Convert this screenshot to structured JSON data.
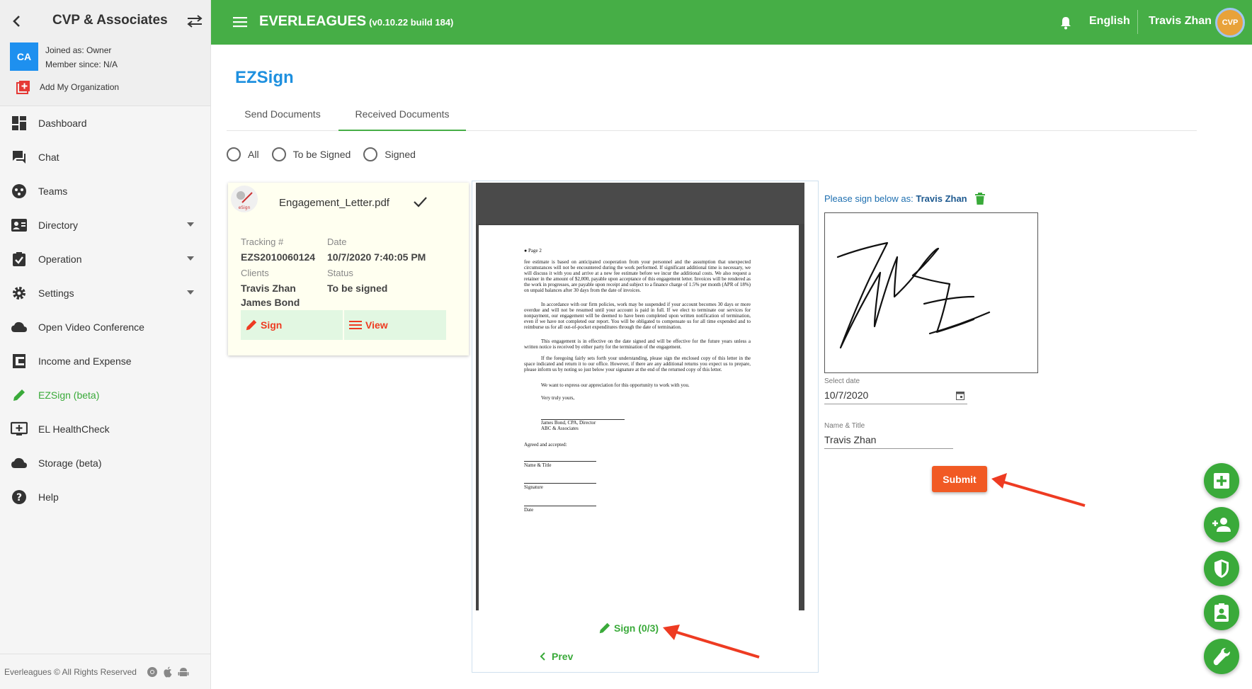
{
  "org": {
    "name": "CVP & Associates",
    "avatar": "CA",
    "joined": "Joined as: Owner",
    "member_since": "Member since: N/A",
    "add_org": "Add My Organization"
  },
  "nav": [
    {
      "label": "Dashboard",
      "icon": "dashboard-icon"
    },
    {
      "label": "Chat",
      "icon": "chat-icon"
    },
    {
      "label": "Teams",
      "icon": "teams-icon"
    },
    {
      "label": "Directory",
      "icon": "directory-icon"
    },
    {
      "label": "Operation",
      "icon": "clipboard-check-icon"
    },
    {
      "label": "Settings",
      "icon": "gear-icon"
    },
    {
      "label": "Open Video Conference",
      "icon": "cloud-icon"
    },
    {
      "label": "Income and Expense",
      "icon": "ledger-icon"
    },
    {
      "label": "EZSign (beta)",
      "icon": "pencil-icon"
    },
    {
      "label": "EL HealthCheck",
      "icon": "monitor-plus-icon"
    },
    {
      "label": "Storage (beta)",
      "icon": "cloud-storage-icon"
    },
    {
      "label": "Help",
      "icon": "help-icon"
    }
  ],
  "footer": {
    "text": "Everleagues © All Rights Reserved"
  },
  "topbar": {
    "title": "EVERLEAGUES",
    "version": "(v0.10.22 build 184)",
    "language": "English",
    "user_name": "Travis Zhan",
    "user_avatar": "CVP"
  },
  "page": {
    "title": "EZSign"
  },
  "tabs": [
    {
      "label": "Send Documents"
    },
    {
      "label": "Received Documents"
    }
  ],
  "filters": [
    {
      "label": "All"
    },
    {
      "label": "To be Signed"
    },
    {
      "label": "Signed"
    }
  ],
  "card": {
    "logo_text": "eSign",
    "file_name": "Engagement_Letter.pdf",
    "tracking_label": "Tracking #",
    "tracking_value": "EZS2010060124",
    "date_label": "Date",
    "date_value": "10/7/2020 7:40:05 PM",
    "clients_label": "Clients",
    "client1": "Travis Zhan",
    "client2": "James Bond",
    "status_label": "Status",
    "status_value": "To be signed",
    "sign_label": "Sign",
    "view_label": "View"
  },
  "document": {
    "page_label": "Page 2",
    "p1": "fee estimate is based on anticipated cooperation from your personnel and the assumption that unexpected circumstances will not be encountered during the work performed. If significant additional time is necessary, we will discuss it with you and arrive at a new fee estimate before we incur the additional costs. We also request a retainer in the amount of $2,000, payable upon acceptance of this engagement letter. Invoices will be rendered as the work in progresses, are payable upon receipt and subject to a finance charge of 1.5% per month (APR of 18%) on unpaid balances after 30 days from the date of invoices.",
    "p2": "In accordance with our firm policies, work may be suspended if your account becomes 30 days or more overdue and will not be resumed until your account is paid in full. If we elect to terminate our services for nonpayment, our engagement will be deemed to have been completed upon written notification of termination, even if we have not completed our report. You will be obligated to compensate us for all time expended and to reimburse us for all out-of-pocket expenditures through the date of termination.",
    "p3": "This engagement is in effective on the date signed and will be effective for the future years unless a written notice is received by either party for the termination of the engagement.",
    "p4": "If the foregoing fairly sets forth your understanding, please sign the enclosed copy of this letter in the space indicated and return it to our office. However, if there are any additional returns you expect us to prepare, please inform us by noting so just below your signature at the end of the returned copy of this letter.",
    "p5": "We want to express our appreciation for this opportunity to work with you.",
    "p6": "Very truly yours,",
    "signer_name": "James Bond, CPA, Director",
    "signer_firm": "ABC & Associates",
    "agreed": "Agreed and accepted:",
    "name_title": "Name & Title",
    "signature": "Signature",
    "date": "Date"
  },
  "viewer": {
    "sign_label": "Sign",
    "sign_count": "(0/3)",
    "prev_label": "Prev"
  },
  "signature_panel": {
    "prompt": "Please sign below as:",
    "signer": "Travis Zhan",
    "date_label": "Select date",
    "date_value": "10/7/2020",
    "name_label": "Name & Title",
    "name_value": "Travis Zhan",
    "submit_label": "Submit"
  },
  "colors": {
    "brand_green": "#46ae46",
    "accent_orange": "#f15a24",
    "title_blue": "#1e90df"
  }
}
